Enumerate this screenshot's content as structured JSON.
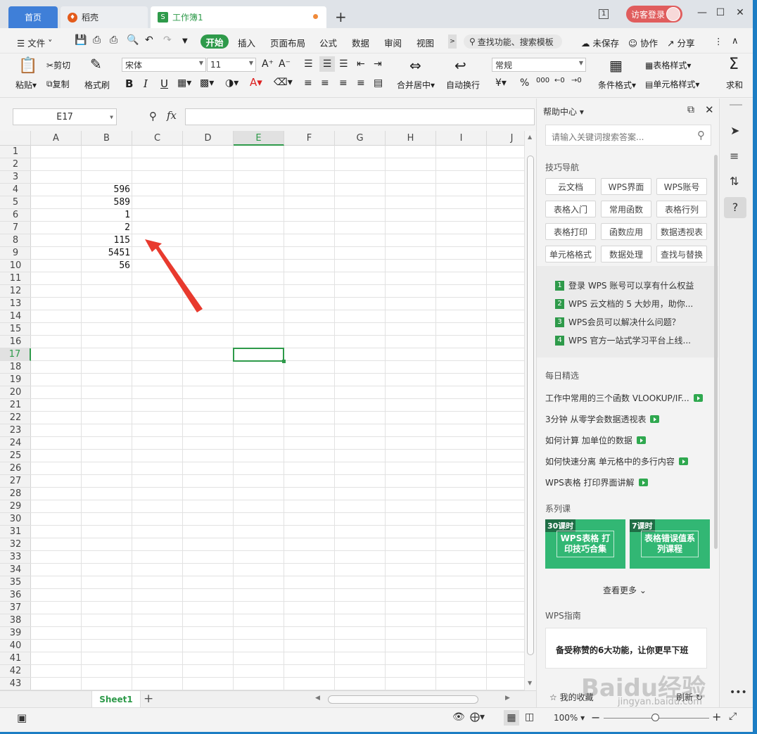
{
  "tabs": {
    "home": "首页",
    "docer": "稻壳",
    "workbook": "工作簿1",
    "window_count": "1",
    "login": "访客登录"
  },
  "menu": {
    "file": "文件",
    "start": "开始",
    "items": [
      "插入",
      "页面布局",
      "公式",
      "数据",
      "审阅",
      "视图"
    ],
    "search": "查找功能、搜索模板",
    "unsaved": "未保存",
    "collab": "协作",
    "share": "分享"
  },
  "ribbon": {
    "paste": "粘贴",
    "cut": "剪切",
    "copy": "复制",
    "format_painter": "格式刷",
    "font": "宋体",
    "size": "11",
    "merge": "合并居中",
    "wrap": "自动换行",
    "number_format": "常规",
    "currency": "¥",
    "percent": "%",
    "cond_format": "条件格式",
    "table_style": "表格样式",
    "cell_style": "单元格样式",
    "sum": "求和"
  },
  "formula_bar": {
    "name_box": "E17",
    "fx": "fx",
    "content": ""
  },
  "grid": {
    "columns": [
      "A",
      "B",
      "C",
      "D",
      "E",
      "F",
      "G",
      "H",
      "I",
      "J"
    ],
    "rows": [
      "1",
      "2",
      "3",
      "4",
      "5",
      "6",
      "7",
      "8",
      "9",
      "10",
      "11",
      "12",
      "13",
      "14",
      "15",
      "16",
      "17",
      "18",
      "19",
      "20",
      "21",
      "22",
      "23",
      "24",
      "25",
      "26",
      "27",
      "28",
      "29",
      "30",
      "31",
      "32",
      "33",
      "34",
      "35",
      "36",
      "37",
      "38",
      "39",
      "40",
      "41",
      "42",
      "43"
    ],
    "values": [
      {
        "cell": "B4",
        "value": "596"
      },
      {
        "cell": "B5",
        "value": "589"
      },
      {
        "cell": "B6",
        "value": "1"
      },
      {
        "cell": "B7",
        "value": "2"
      },
      {
        "cell": "B8",
        "value": "115"
      },
      {
        "cell": "B9",
        "value": "5451"
      },
      {
        "cell": "B10",
        "value": "56"
      }
    ],
    "selected": "E17"
  },
  "sheets": [
    "Sheet1"
  ],
  "panel": {
    "title": "帮助中心",
    "search_placeholder": "请输入关键词搜索答案...",
    "nav_title": "技巧导航",
    "nav_buttons": [
      "云文档",
      "WPS界面",
      "WPS账号",
      "表格入门",
      "常用函数",
      "表格行列",
      "表格打印",
      "函数应用",
      "数据透视表",
      "单元格格式",
      "数据处理",
      "查找与替换"
    ],
    "articles": [
      {
        "n": "1",
        "t": "登录 WPS 账号可以享有什么权益"
      },
      {
        "n": "2",
        "t": "WPS 云文档的 5 大妙用，助你..."
      },
      {
        "n": "3",
        "t": "WPS会员可以解决什么问题？"
      },
      {
        "n": "4",
        "t": "WPS 官方一站式学习平台上线..."
      }
    ],
    "daily_title": "每日精选",
    "daily": [
      "工作中常用的三个函数 VLOOKUP/IF...",
      "3分钟 从零学会数据透视表",
      "如何计算 加单位的数据",
      "如何快速分离 单元格中的多行内容",
      "WPS表格 打印界面讲解"
    ],
    "series_title": "系列课",
    "courses": [
      {
        "badge": "30课时",
        "title": "WPS表格 打印技巧合集"
      },
      {
        "badge": "7课时",
        "title": "表格错误值系列课程"
      }
    ],
    "more": "查看更多",
    "guide_title": "WPS指南",
    "guide_card": "备受称赞的6大功能，让你更早下班",
    "favorites": "我的收藏",
    "refresh": "刷新"
  },
  "status": {
    "zoom": "100%"
  },
  "watermark": {
    "brand": "Baidu经验",
    "url": "jingyan.baidu.com"
  }
}
